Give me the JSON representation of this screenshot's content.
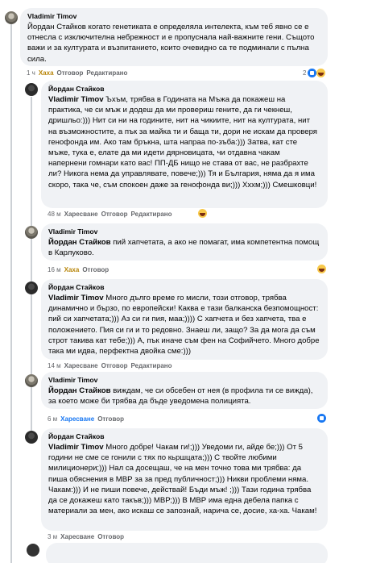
{
  "comments": [
    {
      "author": "Vladimir Timov",
      "mention": "",
      "text": "Йордан Стайков когато генетиката е определяла интелекта, към теб явно се е отнесла с изключителна небрежност и е пропуснала най-важните гени. Същото важи и за културата и възпитанието, които очевидно са те подминали с пълна сила.",
      "actions": {
        "time": "1 ч",
        "react": "Хаха",
        "reply": "Отговор",
        "edited": "Редактирано"
      },
      "reactions": {
        "count": "2",
        "icons": [
          "like-icon",
          "laugh-icon"
        ]
      }
    },
    {
      "author": "Йордан Стайков",
      "mention": "Vladimir Timov",
      "text": " Ъхъм, трябва в Годината на Мъжа да покажеш на практика, че си мъж и додеш да ми провериш гените, да ги чекнеш, дришльо:))) Нит си ни на годините, нит на чикиите, нит на културата, нит на възможностите, а пък за майка ти и баща ти, дори не искам да проверя генофонда им. Ако там бръкна, шта напраа по-зъба:))) Затва, кат сте мъже, тука е, елате да ми идети дярновицата, чи отдавна чакам напернени гомнари като вас! ПП-ДБ нищо не става от вас, не разбрахте ли? Никога нема да управлявате, повече;))) Тя и България, няма да я има скоро, така че, съм спокоен даже за генофонда ви;))) Хххм;))) Смешковци!",
      "actions": {
        "time": "48 м",
        "react": "Харесване",
        "reply": "Отговор",
        "edited": "Редактирано"
      },
      "reactions": {
        "count": "",
        "icons": [
          "laugh-icon"
        ]
      }
    },
    {
      "author": "Vladimir Timov",
      "mention": "Йордан Стайков",
      "text": " пий хапчетата, а ако не помагат, има компетентна помощ в Карлуково.",
      "actions": {
        "time": "16 м",
        "react": "Хаха",
        "reply": "Отговор",
        "edited": ""
      },
      "reactions": {
        "count": "",
        "icons": [
          "laugh-icon"
        ]
      }
    },
    {
      "author": "Йордан Стайков",
      "mention": "Vladimir Timov",
      "text": " Много дълго време го мисли, този отговор, трябва динамично и бързо, по европейски! Каква е тази балканска безпомощност: пий си хапчетата;))) Аз си ги пия, маа;)))) С хапчета и без хапчета, тва е положението. Пия си ги и то редовно. Знаеш ли, защо? За да мога да съм строт такива кат тебе;))) А, пък иначе съм фен на Софийчето. Много добре така ми идва, перфектна двойка сме:)))",
      "actions": {
        "time": "14 м",
        "react": "Харесване",
        "reply": "Отговор",
        "edited": "Редактирано"
      },
      "reactions": {
        "count": "",
        "icons": []
      }
    },
    {
      "author": "Vladimir Timov",
      "mention": "Йордан Стайков",
      "text": " виждам, че си обсебен от нея (в профила ти се вижда), за което може би трябва да бъде уведомена полицията.",
      "actions": {
        "time": "6 м",
        "react": "Харесване",
        "reply": "Отговор",
        "edited": ""
      },
      "reactions": {
        "count": "",
        "icons": [
          "like-icon"
        ]
      }
    },
    {
      "author": "Йордан Стайков",
      "mention": "Vladimir Timov",
      "text": " Много добре! Чакам ги!;))) Уведоми ги, айде бе;))) От 5 години не сме се гонили с тях по кьршцата;))) С твойте любими милиционери;))) Нал са досещаш, че на мен точно това ми трябва: да пиша обяснения в МВР за за пред публичност;))) Никви проблеми няма. Чакам:))) И не пиши повече, действай! Бъди мъж! ;))) Тази година трябва да се докажеш като такъв;))) МВР;))) В МВР има една дебела папка с материали за мен, ако искаш се запознай, нарича се, досие, ха-ха. Чакам!",
      "actions": {
        "time": "3 м",
        "react": "Харесване",
        "reply": "Отговор",
        "edited": ""
      },
      "reactions": {
        "count": "",
        "icons": []
      }
    }
  ]
}
